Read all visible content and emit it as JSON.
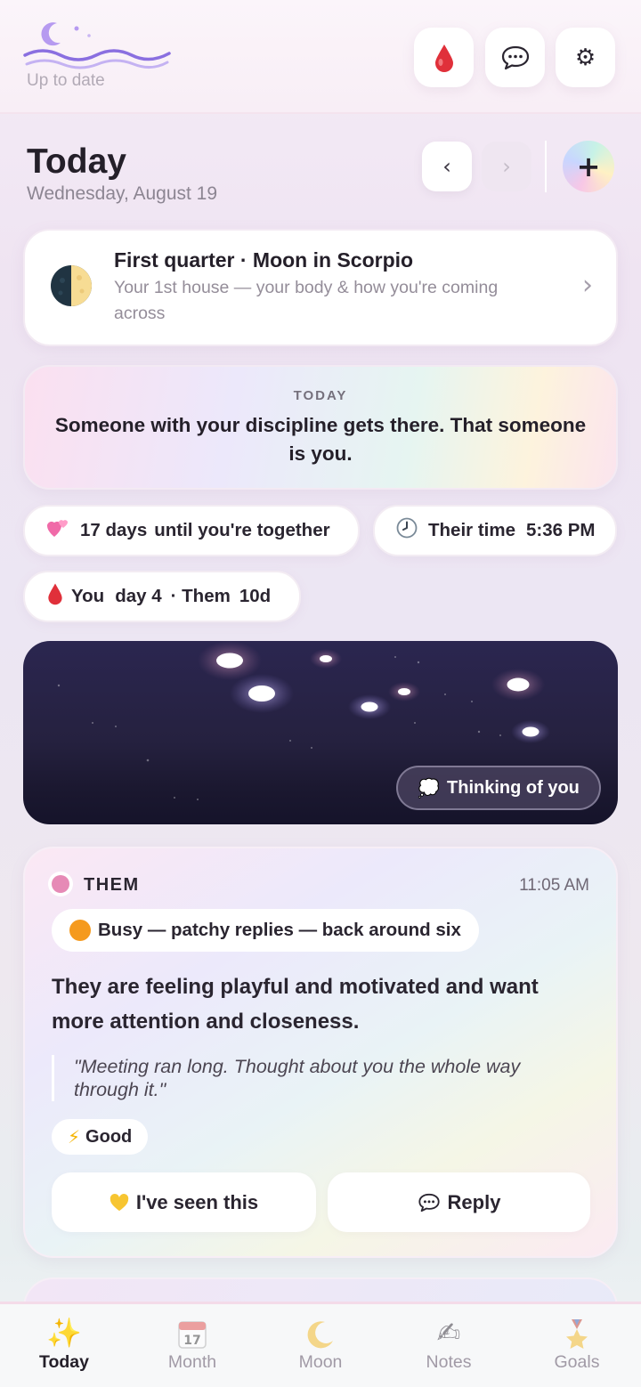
{
  "header": {
    "status": "Up to date",
    "icons": [
      "blood-drop-icon",
      "chat-bubble-icon",
      "gear-icon"
    ]
  },
  "date_section": {
    "title": "Today",
    "date": "Wednesday, August 19",
    "prev": "‹",
    "next": "›",
    "add": "+"
  },
  "moon": {
    "title": "First quarter · Moon in Scorpio",
    "subtitle": "Your 1st house — your body & how you're coming across",
    "chevron": "›"
  },
  "daily_quote": {
    "label": "TODAY",
    "text": "Someone with your discipline gets there. That someone is you."
  },
  "stats": {
    "together_count": "17 days",
    "together_text": "until you're together",
    "their_time_label": "Their time",
    "their_time_value": "5:36 PM",
    "you_label": "You",
    "you_day": "day 4",
    "them_label": "· Them",
    "them_day": "10d"
  },
  "sky": {
    "button_label": "Thinking of you"
  },
  "them_card": {
    "label": "THEM",
    "time": "11:05 AM",
    "status": "Busy — patchy replies — back around six",
    "feeling": "They are feeling playful and motivated and want more attention and closeness.",
    "message": "\"Meeting ran long. Thought about you the whole way through it.\"",
    "energy": "Good",
    "seen_button": "I've seen this",
    "reply_button": "Reply"
  },
  "tabs": [
    {
      "label": "Today",
      "icon": "sparkles-icon",
      "active": true
    },
    {
      "label": "Month",
      "icon": "calendar-icon",
      "active": false
    },
    {
      "label": "Moon",
      "icon": "crescent-moon-icon",
      "active": false
    },
    {
      "label": "Notes",
      "icon": "writing-hand-icon",
      "active": false
    },
    {
      "label": "Goals",
      "icon": "medal-icon",
      "active": false
    }
  ],
  "colors": {
    "accent_pink": "#e68ab6",
    "busy_orange": "#f59a1e",
    "blood_red": "#e0303a",
    "sky_dark": "#25213f"
  }
}
